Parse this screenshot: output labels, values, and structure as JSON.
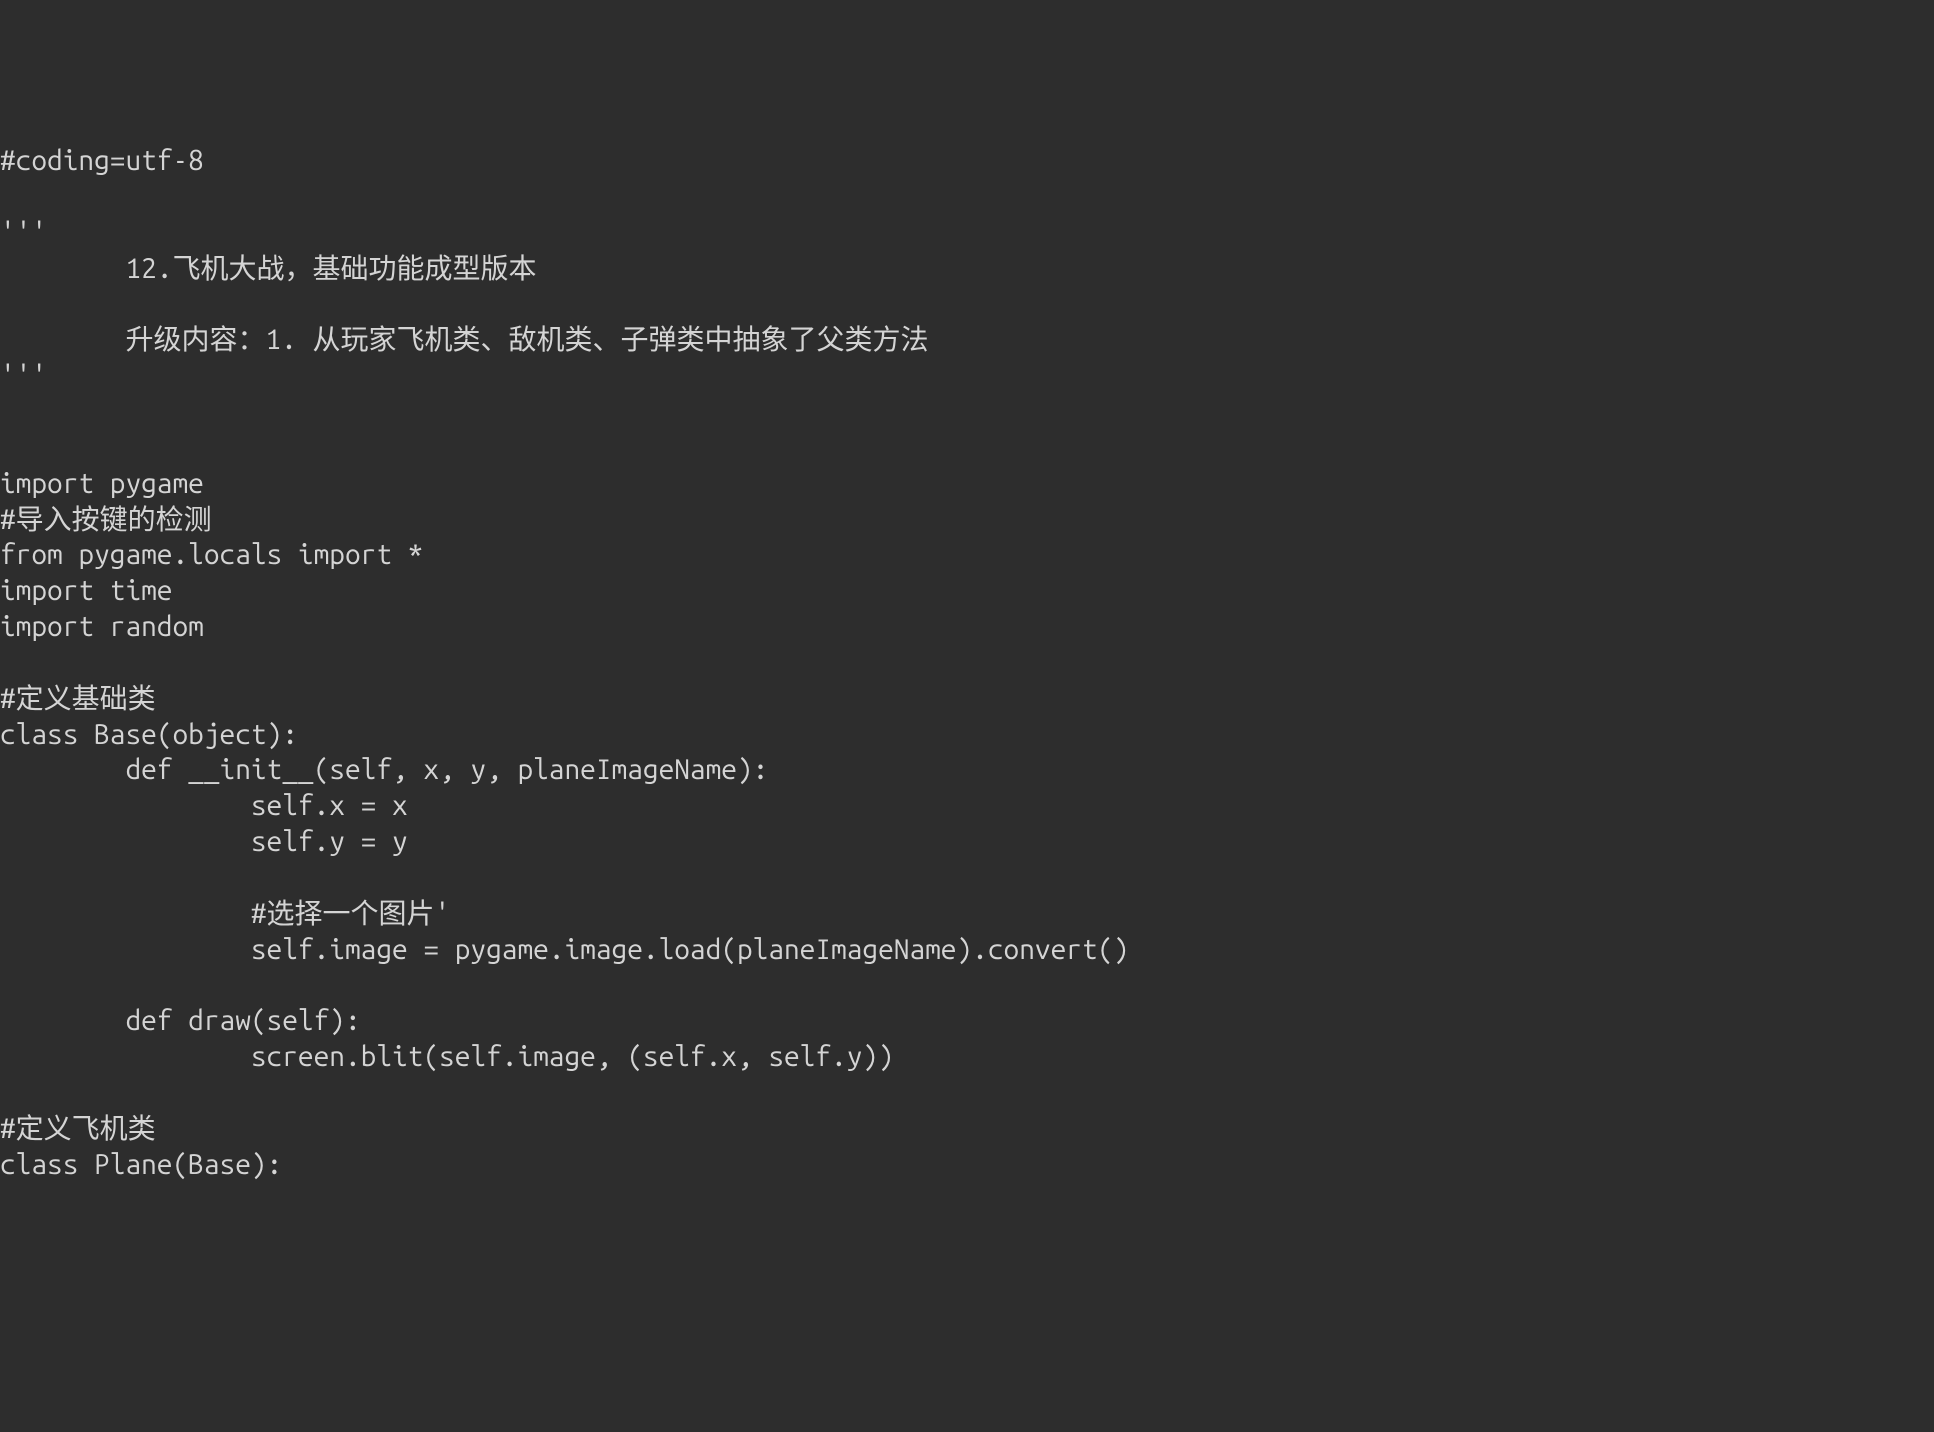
{
  "code": {
    "lines": [
      "#coding=utf-8",
      "",
      "'''",
      "        12.飞机大战，基础功能成型版本",
      "",
      "        升级内容：1. 从玩家飞机类、敌机类、子弹类中抽象了父类方法",
      "'''",
      "",
      "",
      "import pygame",
      "#导入按键的检测",
      "from pygame.locals import *",
      "import time",
      "import random",
      "",
      "#定义基础类",
      "class Base(object):",
      "        def __init__(self, x, y, planeImageName):",
      "                self.x = x",
      "                self.y = y",
      "",
      "                #选择一个图片'",
      "                self.image = pygame.image.load(planeImageName).convert()",
      "",
      "        def draw(self):",
      "                screen.blit(self.image, (self.x, self.y))",
      "",
      "#定义飞机类",
      "class Plane(Base):"
    ]
  }
}
